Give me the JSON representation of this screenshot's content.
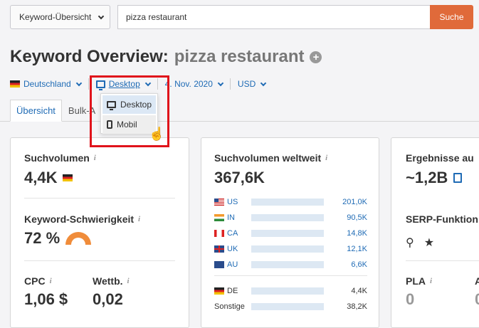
{
  "header": {
    "database_select": "Keyword-Übersicht",
    "search_value": "pizza restaurant",
    "search_button": "Suche"
  },
  "title": {
    "main": "Keyword Overview:",
    "keyword": "pizza restaurant"
  },
  "filters": {
    "country": "Deutschland",
    "device": "Desktop",
    "date": "4. Nov. 2020",
    "currency": "USD"
  },
  "device_menu": {
    "items": [
      "Desktop",
      "Mobil"
    ],
    "selected": "Desktop",
    "hovered": "Mobil"
  },
  "tabs": [
    "Übersicht",
    "Bulk-A"
  ],
  "card1": {
    "volume_label": "Suchvolumen",
    "volume_value": "4,4K",
    "kd_label": "Keyword-Schwierigkeit",
    "kd_value": "72 %",
    "kd_percent": 72,
    "cpc_label": "CPC",
    "cpc_value": "1,06 $",
    "comp_label": "Wettb.",
    "comp_value": "0,02"
  },
  "card2": {
    "label": "Suchvolumen weltweit",
    "value": "367,6K",
    "countries": [
      {
        "code": "US",
        "value": "201,0K",
        "share": 0.55
      },
      {
        "code": "IN",
        "value": "90,5K",
        "share": 0.25
      },
      {
        "code": "CA",
        "value": "14,8K",
        "share": 0.04
      },
      {
        "code": "UK",
        "value": "12,1K",
        "share": 0.035
      },
      {
        "code": "AU",
        "value": "6,6K",
        "share": 0.02
      }
    ],
    "extra": [
      {
        "code": "DE",
        "value": "4,4K",
        "share": 0.015
      },
      {
        "code": "Sonstige",
        "value": "38,2K",
        "share": 0.1
      }
    ]
  },
  "card3": {
    "results_label": "Ergebnisse au",
    "results_value": "~1,2B",
    "serp_label": "SERP-Funktion",
    "pla_label": "PLA",
    "pla_value": "0",
    "a_label": "A",
    "a_value": "0"
  },
  "colors": {
    "accent": "#e06a3a",
    "link": "#1f6bb5",
    "bar": "#4a90d9",
    "highlight": "#e0131b"
  }
}
